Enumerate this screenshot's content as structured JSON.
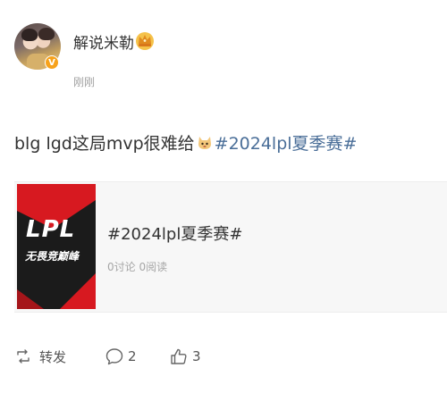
{
  "post": {
    "author": "解说米勒",
    "verified_badge": "V",
    "timestamp": "刚刚",
    "text": "blg lgd这局mvp很难给",
    "hashtag": "#2024lpl夏季赛#",
    "icons": {
      "crown": "crown-icon",
      "emoji": "dog-face-emoji-icon"
    }
  },
  "card": {
    "logo_text": "LPL",
    "logo_subtext": "无畏竞巅峰",
    "title": "#2024lpl夏季赛#",
    "meta": "0讨论 0阅读",
    "colors": {
      "thumb_bg": "#1b1b1b",
      "accent": "#d71920"
    }
  },
  "actions": {
    "repost_label": "转发",
    "comment_count": "2",
    "like_count": "3"
  },
  "colors": {
    "link": "#4a6e98",
    "text": "#333333",
    "muted": "#a0a0a0"
  }
}
